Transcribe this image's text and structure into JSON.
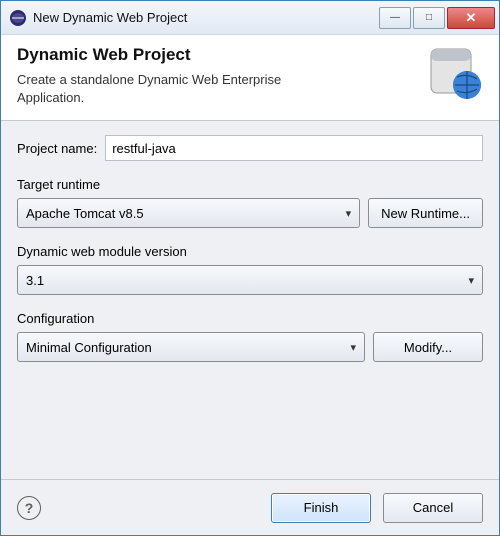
{
  "window": {
    "title": "New Dynamic Web Project"
  },
  "banner": {
    "heading": "Dynamic Web Project",
    "description": "Create a standalone Dynamic Web Enterprise Application."
  },
  "projectName": {
    "label": "Project name:",
    "value": "restful-java"
  },
  "targetRuntime": {
    "groupLabel": "Target runtime",
    "selected": "Apache Tomcat v8.5",
    "newButton": "New Runtime..."
  },
  "moduleVersion": {
    "groupLabel": "Dynamic web module version",
    "selected": "3.1"
  },
  "configuration": {
    "groupLabel": "Configuration",
    "selected": "Minimal Configuration",
    "modifyButton": "Modify..."
  },
  "footer": {
    "helpTooltip": "?",
    "finish": "Finish",
    "cancel": "Cancel"
  }
}
